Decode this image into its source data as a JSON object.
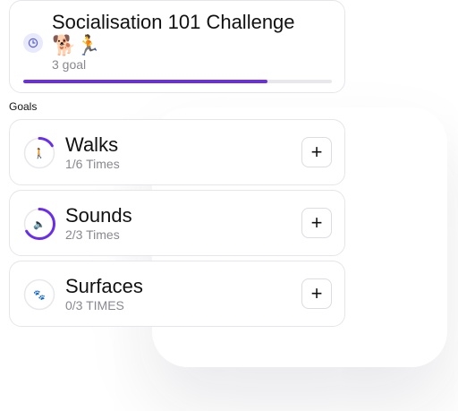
{
  "challenge": {
    "title": "Socialisation 101 Challenge 🐕🏃",
    "subtitle": "3 goal",
    "icon": "clock-icon",
    "progress_percent": 79
  },
  "goals_section": {
    "label": "Goals"
  },
  "goals": [
    {
      "name": "Walks",
      "count": "1/6 Times",
      "icon": "person-walking-icon",
      "emoji": "🚶",
      "progress_fraction": 0.1667
    },
    {
      "name": "Sounds",
      "count": "2/3 Times",
      "icon": "speaker-icon",
      "emoji": "🔈",
      "progress_fraction": 0.6667
    },
    {
      "name": "Surfaces",
      "count": "0/3 TIMES",
      "icon": "paw-prints-icon",
      "emoji": "🐾",
      "progress_fraction": 0
    }
  ],
  "add_button": {
    "label": "+"
  },
  "colors": {
    "accent": "#6a2ee8",
    "track": "#e8e8ec",
    "muted_text": "#888890"
  }
}
